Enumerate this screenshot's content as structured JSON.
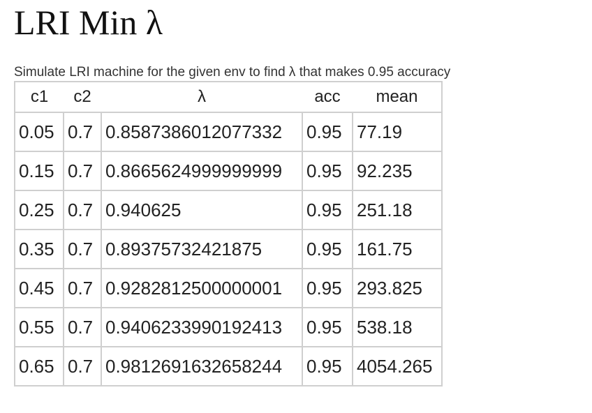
{
  "title": "LRI Min λ",
  "subtitle": "Simulate LRI machine for the given env to find λ that makes 0.95 accuracy",
  "table": {
    "headers": {
      "c1": "c1",
      "c2": "c2",
      "lambda": "λ",
      "acc": "acc",
      "mean": "mean"
    },
    "rows": [
      {
        "c1": "0.05",
        "c2": "0.7",
        "lambda": "0.8587386012077332",
        "acc": "0.95",
        "mean": "77.19"
      },
      {
        "c1": "0.15",
        "c2": "0.7",
        "lambda": "0.8665624999999999",
        "acc": "0.95",
        "mean": "92.235"
      },
      {
        "c1": "0.25",
        "c2": "0.7",
        "lambda": "0.940625",
        "acc": "0.95",
        "mean": "251.18"
      },
      {
        "c1": "0.35",
        "c2": "0.7",
        "lambda": "0.89375732421875",
        "acc": "0.95",
        "mean": "161.75"
      },
      {
        "c1": "0.45",
        "c2": "0.7",
        "lambda": "0.9282812500000001",
        "acc": "0.95",
        "mean": "293.825"
      },
      {
        "c1": "0.55",
        "c2": "0.7",
        "lambda": "0.9406233990192413",
        "acc": "0.95",
        "mean": "538.18"
      },
      {
        "c1": "0.65",
        "c2": "0.7",
        "lambda": "0.9812691632658244",
        "acc": "0.95",
        "mean": "4054.265"
      }
    ]
  }
}
